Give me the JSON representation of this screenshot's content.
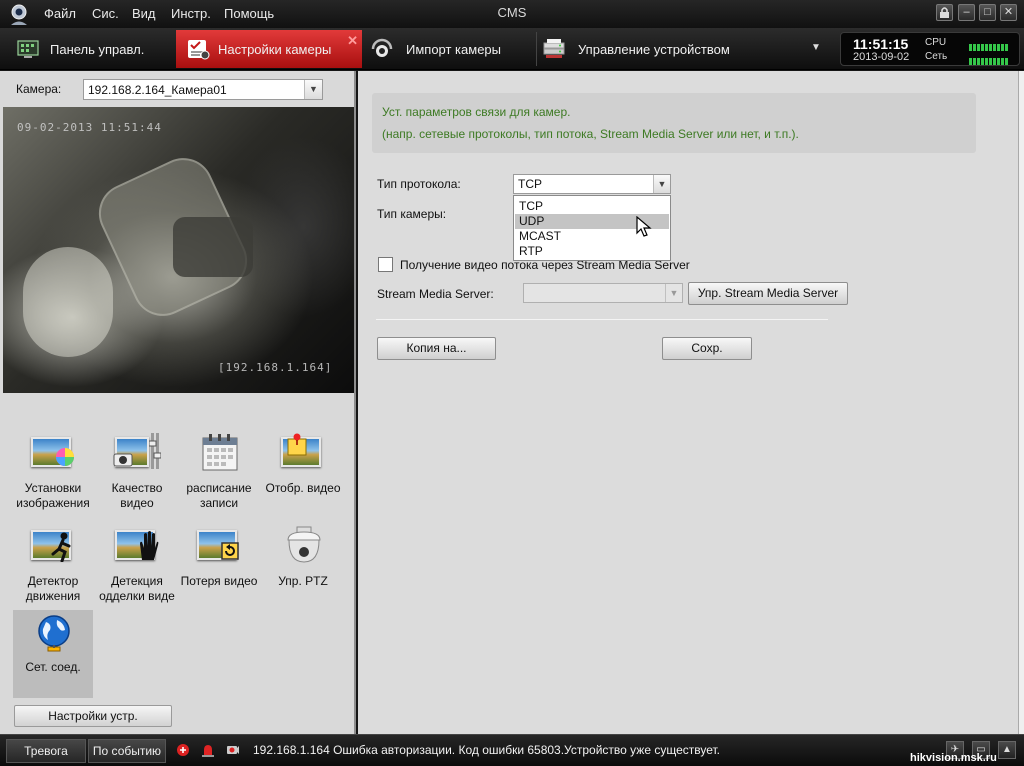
{
  "titlebar": {
    "title": "CMS",
    "menu": [
      "Файл",
      "Сис.",
      "Вид",
      "Инстр.",
      "Помощь"
    ]
  },
  "tabs": [
    {
      "label": "Панель управл.",
      "icon": "control-panel-icon",
      "active": false
    },
    {
      "label": "Настройки камеры",
      "icon": "camera-settings-icon",
      "active": true
    },
    {
      "label": "Импорт камеры",
      "icon": "camera-import-icon",
      "active": false
    },
    {
      "label": "Управление устройством",
      "icon": "device-management-icon",
      "active": false
    }
  ],
  "clock": {
    "time": "11:51:15",
    "date": "2013-09-02"
  },
  "meters": {
    "cpu_label": "CPU",
    "net_label": "Сеть"
  },
  "left_panel": {
    "camera_label": "Камера:",
    "camera_value": "192.168.2.164_Камера01",
    "preview": {
      "osd_time": "09-02-2013 11:51:44",
      "osd_ip": "[192.168.1.164]"
    },
    "tiles": [
      {
        "label": "Установки изображения",
        "icon": "image-settings-icon"
      },
      {
        "label": "Качество видео",
        "icon": "video-quality-icon"
      },
      {
        "label": "расписание записи",
        "icon": "record-schedule-icon"
      },
      {
        "label": "Отобр. видео",
        "icon": "video-display-icon"
      },
      {
        "label": "Детектор движения",
        "icon": "motion-detection-icon"
      },
      {
        "label": "Детекция одделки виде",
        "icon": "tamper-detection-icon"
      },
      {
        "label": "Потеря видео",
        "icon": "video-loss-icon"
      },
      {
        "label": "Упр. PTZ",
        "icon": "ptz-dome-icon"
      },
      {
        "label": "Сет. соед.",
        "icon": "network-globe-icon",
        "active": true
      }
    ],
    "device_settings_button": "Настройки устр."
  },
  "right_panel": {
    "info_line1": "Уст. параметров связи для камер.",
    "info_line2": "(напр. сетевые протоколы, тип потока, Stream Media Server или нет, и т.п.).",
    "protocol_label": "Тип протокола:",
    "protocol_value": "TCP",
    "protocol_options": [
      "TCP",
      "UDP",
      "MCAST",
      "RTP"
    ],
    "protocol_hover": "UDP",
    "camera_type_label": "Тип камеры:",
    "sms_checkbox_label": "Получение видео потока через Stream Media Server",
    "sms_checked": false,
    "sms_label": "Stream Media Server:",
    "sms_value": "",
    "sms_manage_button": "Упр. Stream Media Server",
    "copy_button": "Копия на...",
    "save_button": "Сохр."
  },
  "statusbar": {
    "alarm_tab": "Тревога",
    "event_tab": "По событию",
    "message": "192.168.1.164 Ошибка авторизации. Код ошибки 65803.Устройство уже существует.",
    "watermark": "hikvision.msk.ru"
  },
  "colors": {
    "active_tab": "#d42020",
    "info_text": "#3d7a23",
    "meter": "#35c84a"
  }
}
